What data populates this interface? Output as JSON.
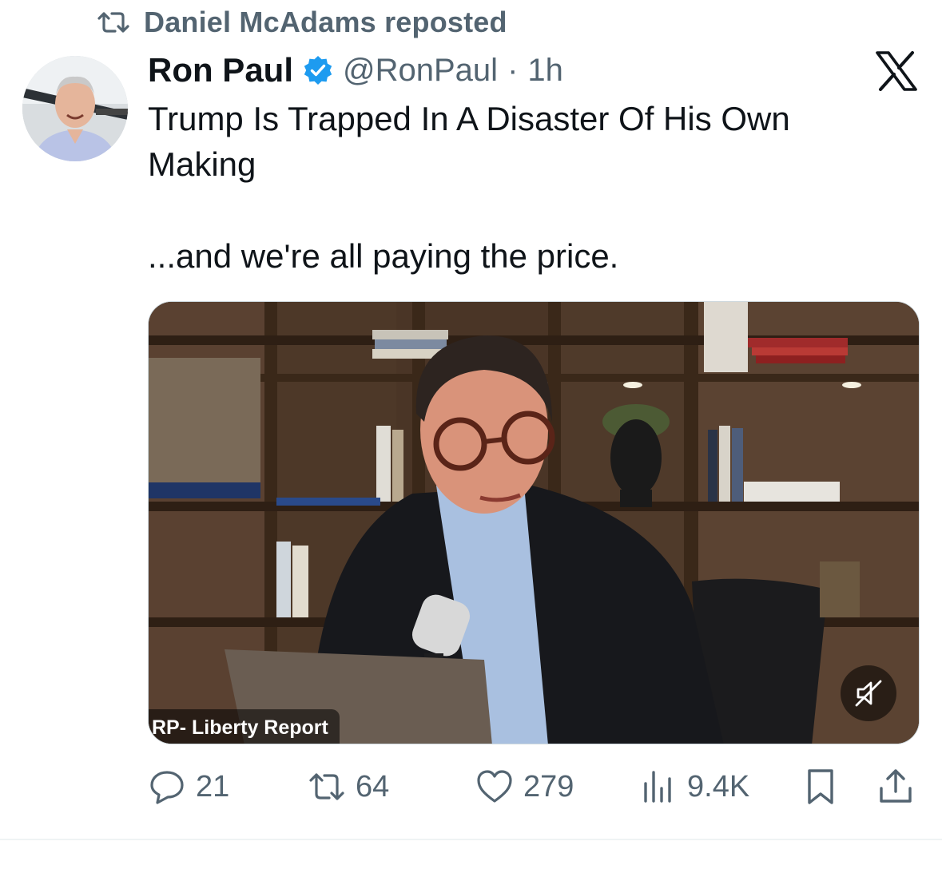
{
  "repost": {
    "text": "Daniel McAdams reposted",
    "icon": "repost-icon"
  },
  "author": {
    "name": "Ron Paul",
    "verified": true,
    "handle": "@RonPaul",
    "separator": "·",
    "time": "1h",
    "avatar_icon": "avatar-photo"
  },
  "platform_logo": "x-logo-icon",
  "tweet": {
    "line1": "Trump Is Trapped In A Disaster Of His Own",
    "line2": "Making",
    "line3": "...and we're all paying the price."
  },
  "video": {
    "source_label": "RP- Liberty Report",
    "muted": true,
    "mute_icon": "speaker-muted-icon"
  },
  "actions": {
    "replies": "21",
    "reposts": "64",
    "likes": "279",
    "views": "9.4K",
    "bookmark_icon": "bookmark-icon",
    "share_icon": "share-icon"
  },
  "colors": {
    "text_primary": "#0f1419",
    "text_secondary": "#536471",
    "verified_blue": "#1d9bf0"
  }
}
